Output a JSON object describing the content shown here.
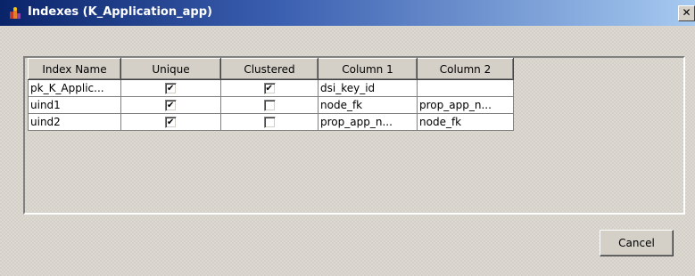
{
  "window": {
    "title": "Indexes (K_Application_app)",
    "icon": "app-icon",
    "close_label": "✕"
  },
  "table": {
    "columns": [
      "Index Name",
      "Unique",
      "Clustered",
      "Column 1",
      "Column 2"
    ],
    "rows": [
      {
        "name": "pk_K_Applic...",
        "unique": true,
        "clustered": true,
        "column1": "dsi_key_id",
        "column2": ""
      },
      {
        "name": "uind1",
        "unique": true,
        "clustered": false,
        "column1": "node_fk",
        "column2": "prop_app_n..."
      },
      {
        "name": "uind2",
        "unique": true,
        "clustered": false,
        "column1": "prop_app_n...",
        "column2": "node_fk"
      }
    ]
  },
  "buttons": {
    "cancel": "Cancel"
  },
  "colors": {
    "title_bar_start": "#0a246a",
    "title_bar_end": "#a6caf0",
    "dialog_face": "#d4d0c8"
  }
}
